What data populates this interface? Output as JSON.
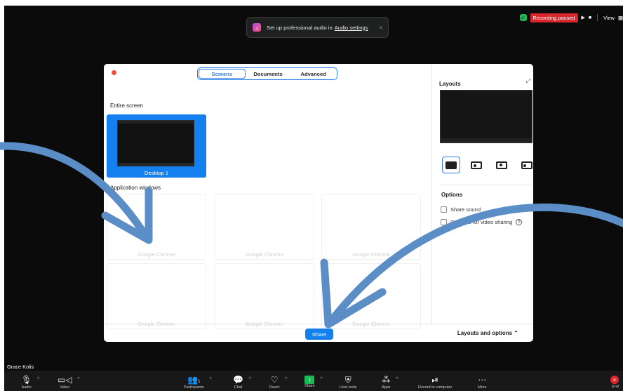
{
  "notification": {
    "text": "Set up professional audio in",
    "link": "Audio settings",
    "close": "×",
    "icon": "music-app-icon"
  },
  "recording": {
    "status": "Recording paused",
    "play": "▶",
    "stop": "■",
    "view": "View"
  },
  "dialog": {
    "tabs": [
      "Screens",
      "Documents",
      "Advanced"
    ],
    "active_tab": "Screens",
    "entire_screen_title": "Entire screen",
    "desktop_label": "Desktop 1",
    "app_windows_title": "Application windows",
    "windows": [
      "Google Chrome",
      "Google Chrome",
      "Google Chrome",
      "Google Chrome",
      "Google Chrome",
      "Google Chrome"
    ],
    "right_panel": {
      "layouts_title": "Layouts",
      "options_title": "Options",
      "option_1": "Share sound",
      "option_2": "Optimize for video sharing",
      "help": "?"
    },
    "share_button": "Share",
    "layouts_and_options": "Layouts and options ⌃"
  },
  "participant_name": "Grace Kolis",
  "toolbar": {
    "items": [
      {
        "label": "Audio",
        "icon": "microphone-icon",
        "glyph": "🎙"
      },
      {
        "label": "Video",
        "icon": "video-camera-icon",
        "glyph": "▭"
      },
      {
        "label": "Participants",
        "icon": "participants-icon",
        "glyph": "👥",
        "count": "1"
      },
      {
        "label": "Chat",
        "icon": "chat-icon",
        "glyph": "💬"
      },
      {
        "label": "React",
        "icon": "react-icon",
        "glyph": "♡"
      },
      {
        "label": "Share",
        "icon": "share-screen-icon",
        "glyph": "↑"
      },
      {
        "label": "Host tools",
        "icon": "shield-icon",
        "glyph": "⛨"
      },
      {
        "label": "Apps",
        "icon": "apps-icon",
        "glyph": "⁂"
      },
      {
        "label": "Record to computer",
        "icon": "record-icon",
        "glyph": "⏯"
      },
      {
        "label": "More",
        "icon": "more-icon",
        "glyph": "⋯"
      }
    ],
    "end_label": "End",
    "end_glyph": "×"
  },
  "colors": {
    "accent": "#1480f0",
    "recording_red": "#d9262c",
    "shield_green": "#1db954",
    "annotation_arrow": "#5b8ec7"
  }
}
